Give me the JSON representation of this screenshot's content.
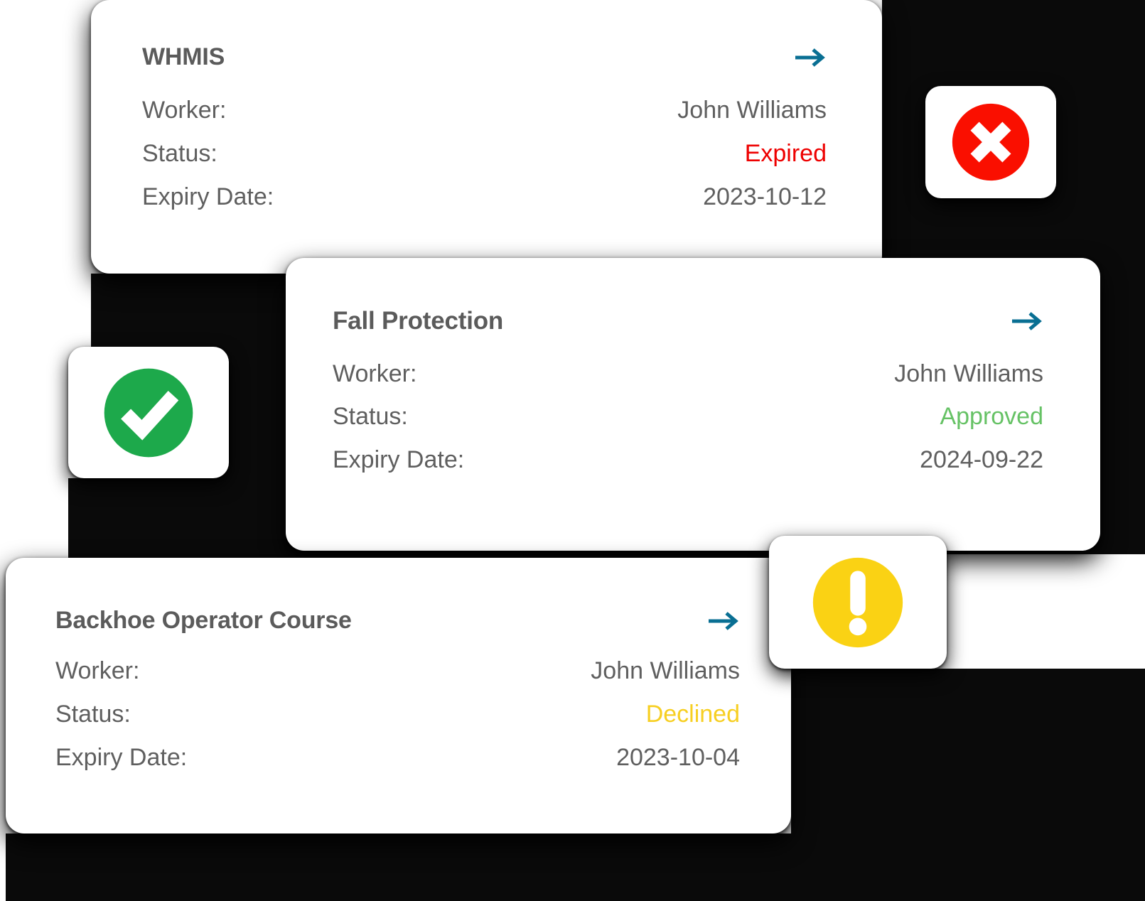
{
  "cards": [
    {
      "title": "WHMIS",
      "arrow_icon": "arrow-right-icon",
      "rows": [
        {
          "label": "Worker:",
          "value": "John Williams",
          "kind": "worker"
        },
        {
          "label": "Status:",
          "value": "Expired",
          "kind": "status-expired"
        },
        {
          "label": "Expiry Date:",
          "value": "2023-10-12",
          "kind": "expiry"
        }
      ]
    },
    {
      "title": "Fall Protection",
      "arrow_icon": "arrow-right-icon",
      "rows": [
        {
          "label": "Worker:",
          "value": "John Williams",
          "kind": "worker"
        },
        {
          "label": "Status:",
          "value": "Approved",
          "kind": "status-approved"
        },
        {
          "label": "Expiry Date:",
          "value": "2024-09-22",
          "kind": "expiry"
        }
      ]
    },
    {
      "title": "Backhoe Operator Course",
      "arrow_icon": "arrow-right-icon",
      "rows": [
        {
          "label": "Worker:",
          "value": "John Williams",
          "kind": "worker"
        },
        {
          "label": "Status:",
          "value": "Declined",
          "kind": "status-declined"
        },
        {
          "label": "Expiry Date:",
          "value": "2023-10-04",
          "kind": "expiry"
        }
      ]
    }
  ],
  "badges": [
    {
      "icon": "error-circle-x-icon",
      "meaning": "Expired",
      "color": "#FA0F00"
    },
    {
      "icon": "success-circle-check-icon",
      "meaning": "Approved",
      "color": "#1DA94B"
    },
    {
      "icon": "warning-circle-exclaim-icon",
      "meaning": "Declined",
      "color": "#FAD214"
    }
  ],
  "colors": {
    "label_text": "#5f5f5f",
    "title_text": "#5b5b5b",
    "arrow": "#096F93",
    "expired": "#ee0000",
    "approved": "#66c265",
    "declined": "#f7cf22",
    "card_bg": "#ffffff",
    "page_bg": "#ffffff",
    "shadow_plate": "#0a0a0a"
  }
}
